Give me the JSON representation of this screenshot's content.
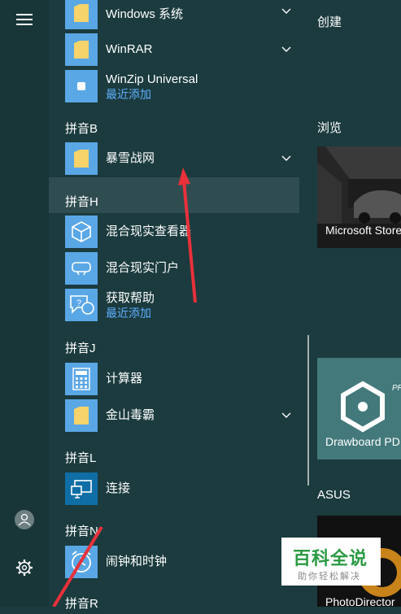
{
  "tiles": {
    "create_label": "创建",
    "browse_label": "浏览",
    "store_name": "Microsoft Store",
    "drawboard_name": "Drawboard PDF",
    "asus_label": "ASUS",
    "photodirector_name": "PhotoDirector"
  },
  "apps": {
    "windows_system": "Windows 系统",
    "winrar": "WinRAR",
    "winzip": "WinZip Universal",
    "winzip_sub": "最近添加",
    "header_b": "拼音B",
    "blizzard": "暴雪战网",
    "header_h": "拼音H",
    "mr_viewer": "混合现实查看器",
    "mr_portal": "混合现实门户",
    "get_help": "获取帮助",
    "get_help_sub": "最近添加",
    "header_j": "拼音J",
    "calculator": "计算器",
    "kingsoft": "金山毒霸",
    "header_l": "拼音L",
    "connect": "连接",
    "header_n": "拼音N",
    "alarms": "闹钟和时钟",
    "header_r": "拼音R"
  },
  "watermark": {
    "title": "百科全说",
    "subtitle": "助你轻松解决"
  },
  "colors": {
    "background": "#1b3b3e",
    "tile_blue": "#5aa7e6",
    "folder_yellow": "#f6d36b",
    "sub_blue": "#5fb0ff",
    "drawboard_teal": "#43797b",
    "arrow_red": "#e8313a"
  }
}
